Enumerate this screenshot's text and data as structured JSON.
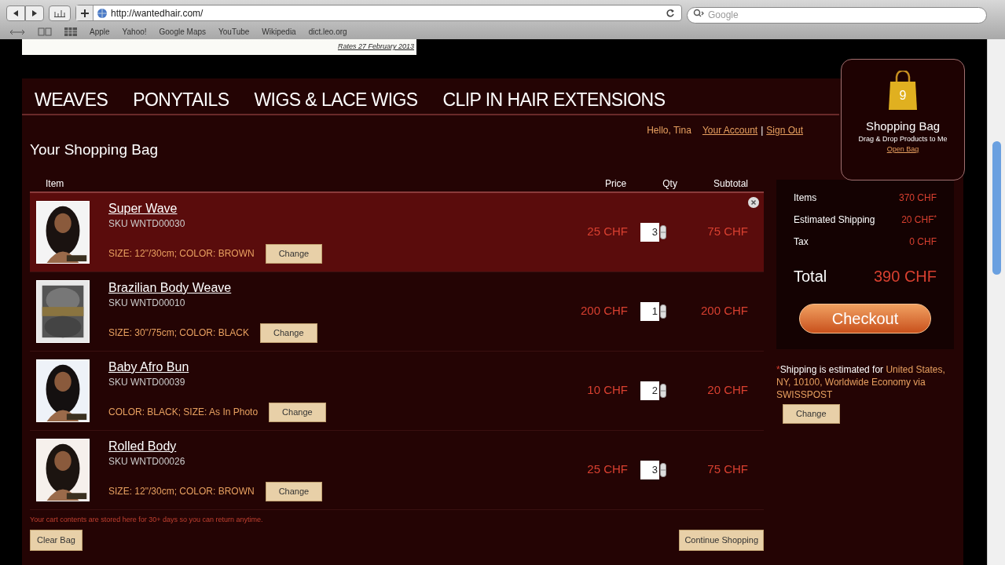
{
  "browser": {
    "url": "http://wantedhair.com/",
    "search_placeholder": "Google",
    "bookmarks": [
      "Apple",
      "Yahoo!",
      "Google Maps",
      "YouTube",
      "Wikipedia",
      "dict.leo.org"
    ]
  },
  "rates_note": "Rates 27 February 2013",
  "nav": [
    "WEAVES",
    "PONYTAILS",
    "WIGS & LACE WIGS",
    "CLIP IN HAIR EXTENSIONS"
  ],
  "bag_widget": {
    "count": "9",
    "title": "Shopping Bag",
    "subtitle": "Drag & Drop Products to Me",
    "link": "Open Bag"
  },
  "user": {
    "greeting": "Hello, Tina",
    "account": "Your Account",
    "separator": "|",
    "sign_out": "Sign Out"
  },
  "title": "Your Shopping Bag",
  "columns": [
    "Item",
    "Price",
    "Qty",
    "Subtotal"
  ],
  "rows": [
    {
      "name": "Super Wave",
      "sku": "SKU WNTD00030",
      "options": "SIZE: 12\"/30cm; COLOR: BROWN",
      "change": "Change",
      "price": "25 CHF",
      "qty": "3",
      "subtotal": "75 CHF",
      "selected": true
    },
    {
      "name": "Brazilian Body Weave",
      "sku": "SKU WNTD00010",
      "options": "SIZE: 30\"/75cm; COLOR: BLACK",
      "change": "Change",
      "price": "200 CHF",
      "qty": "1",
      "subtotal": "200 CHF",
      "selected": false
    },
    {
      "name": "Baby Afro Bun",
      "sku": "SKU WNTD00039",
      "options": "COLOR: BLACK; SIZE: As In Photo",
      "change": "Change",
      "price": "10 CHF",
      "qty": "2",
      "subtotal": "20 CHF",
      "selected": false
    },
    {
      "name": "Rolled Body",
      "sku": "SKU WNTD00026",
      "options": "SIZE: 12\"/30cm; COLOR: BROWN",
      "change": "Change",
      "price": "25 CHF",
      "qty": "3",
      "subtotal": "75 CHF",
      "selected": false
    }
  ],
  "cart_note": "Your cart contents are stored here for 30+ days so you can return anytime.",
  "clear_button": "Clear Bag",
  "continue_button": "Continue Shopping",
  "summary": {
    "lines": [
      {
        "label": "Items",
        "value": "370 CHF"
      },
      {
        "label": "Estimated Shipping",
        "value": "20 CHF",
        "mark": "*"
      },
      {
        "label": "Tax",
        "value": "0 CHF"
      }
    ],
    "total_label": "Total",
    "total_value": "390 CHF",
    "checkout": "Checkout"
  },
  "shipping_note": {
    "mark": "*",
    "text": "Shipping is estimated for",
    "destination": "United States, NY, 10100, Worldwide Economy via SWISSPOST",
    "change": "Change"
  }
}
